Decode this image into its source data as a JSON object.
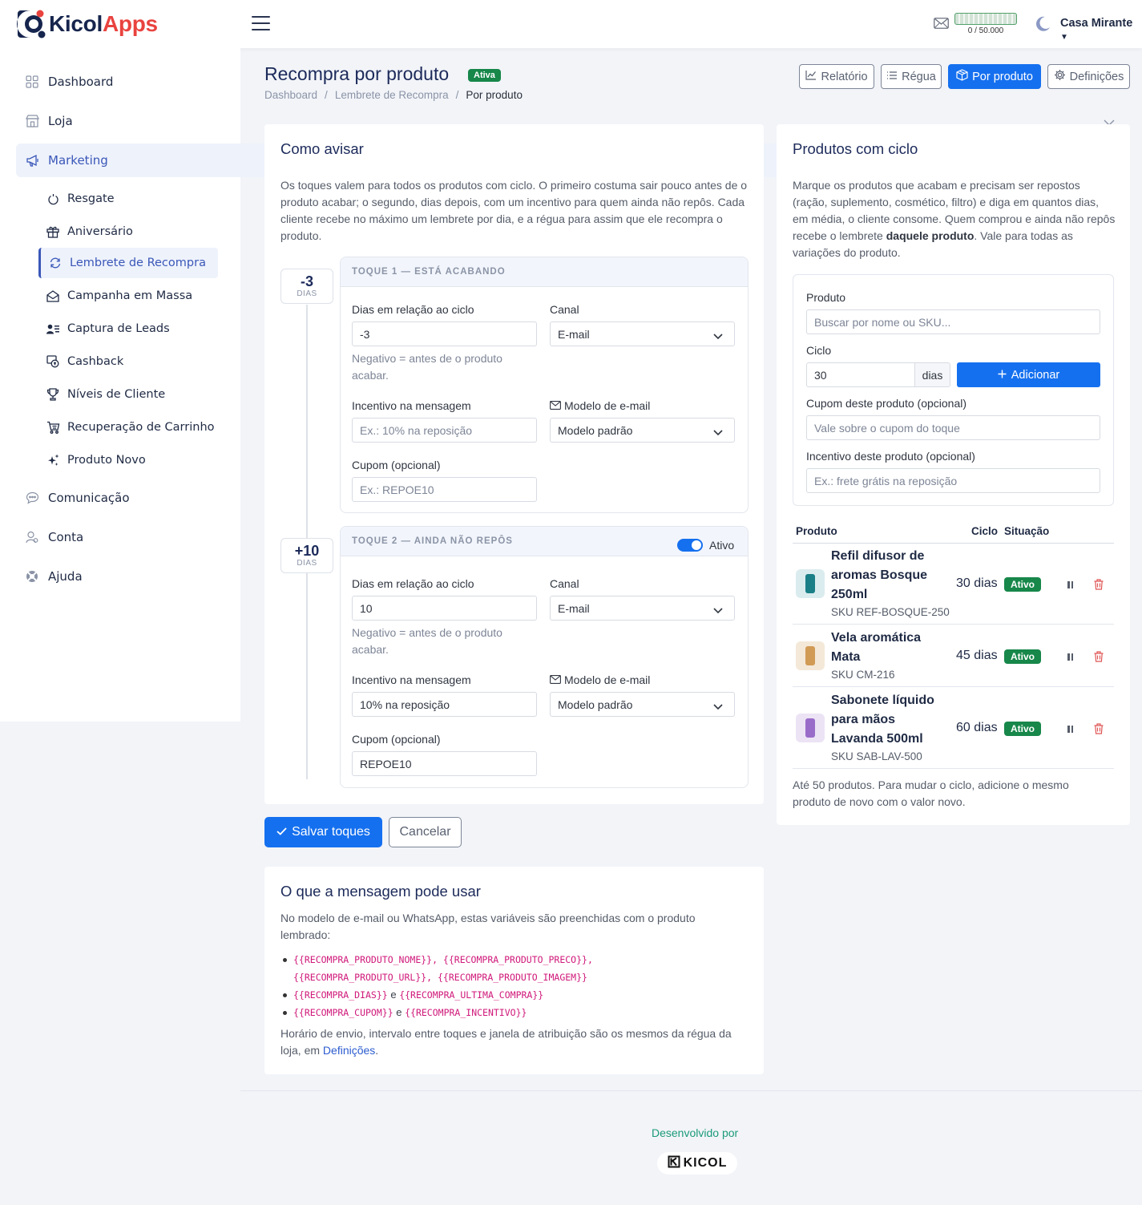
{
  "brand": {
    "name_part1": "Kicol",
    "name_part2": "Apps",
    "accent": "#e9433f",
    "navy": "#16254d"
  },
  "header": {
    "credits": "0 / 50.000",
    "user": "Casa Mirante"
  },
  "sidebar": {
    "items": [
      {
        "label": "Dashboard",
        "icon": "grid-icon"
      },
      {
        "label": "Loja",
        "icon": "store-icon"
      },
      {
        "label": "Marketing",
        "icon": "megaphone-icon"
      },
      {
        "label": "Comunicação",
        "icon": "chat-icon"
      },
      {
        "label": "Conta",
        "icon": "user-icon"
      },
      {
        "label": "Ajuda",
        "icon": "lifebuoy-icon"
      }
    ],
    "marketing_sub": [
      {
        "label": "Resgate",
        "icon": "power-icon"
      },
      {
        "label": "Aniversário",
        "icon": "gift-icon"
      },
      {
        "label": "Lembrete de Recompra",
        "icon": "refresh-icon"
      },
      {
        "label": "Campanha em Massa",
        "icon": "envelope-open-icon"
      },
      {
        "label": "Captura de Leads",
        "icon": "person-lines-icon"
      },
      {
        "label": "Cashback",
        "icon": "cash-icon"
      },
      {
        "label": "Níveis de Cliente",
        "icon": "trophy-icon"
      },
      {
        "label": "Recuperação de Carrinho",
        "icon": "cart-icon"
      },
      {
        "label": "Produto Novo",
        "icon": "sparkle-icon"
      }
    ]
  },
  "page": {
    "title": "Recompra por produto",
    "status": "Ativa",
    "breadcrumb": [
      "Dashboard",
      "Lembrete de Recompra",
      "Por produto"
    ],
    "tabs": [
      "Relatório",
      "Régua",
      "Por produto",
      "Definições"
    ]
  },
  "como_avisar": {
    "title": "Como avisar",
    "desc": "Os toques valem para todos os produtos com ciclo. O primeiro costuma sair pouco antes de o produto acabar; o segundo, dias depois, com um incentivo para quem ainda não repôs. Cada cliente recebe no máximo um lembrete por dia, e a régua para assim que ele recompra o produto.",
    "touches": [
      {
        "day_value": "-3",
        "day_unit": "DIAS",
        "header": "TOQUE 1 — ESTÁ ACABANDO",
        "dias_label": "Dias em relação ao ciclo",
        "dias_value": "-3",
        "hint": "Negativo = antes de o produto acabar.",
        "canal_label": "Canal",
        "canal_value": "E-mail",
        "incentivo_label": "Incentivo na mensagem",
        "incentivo_placeholder": "Ex.: 10% na reposição",
        "incentivo_value": "",
        "modelo_label": "Modelo de e-mail",
        "modelo_value": "Modelo padrão",
        "cupom_label": "Cupom (opcional)",
        "cupom_placeholder": "Ex.: REPOE10",
        "cupom_value": ""
      },
      {
        "day_value": "+10",
        "day_unit": "DIAS",
        "header": "TOQUE 2 — AINDA NÃO REPÔS",
        "toggle_label": "Ativo",
        "dias_label": "Dias em relação ao ciclo",
        "dias_value": "10",
        "hint": "Negativo = antes de o produto acabar.",
        "canal_label": "Canal",
        "canal_value": "E-mail",
        "incentivo_label": "Incentivo na mensagem",
        "incentivo_placeholder": "Ex.: 10% na reposição",
        "incentivo_value": "10% na reposição",
        "modelo_label": "Modelo de e-mail",
        "modelo_value": "Modelo padrão",
        "cupom_label": "Cupom (opcional)",
        "cupom_placeholder": "Ex.: REPOE10",
        "cupom_value": "REPOE10"
      }
    ]
  },
  "actions": {
    "save": "Salvar toques",
    "cancel": "Cancelar"
  },
  "variaveis": {
    "title": "O que a mensagem pode usar",
    "intro": "No modelo de e-mail ou WhatsApp, estas variáveis são preenchidas com o produto lembrado:",
    "line1a": "{{RECOMPRA_PRODUTO_NOME}}, {{RECOMPRA_PRODUTO_PRECO}},",
    "line1b": "{{RECOMPRA_PRODUTO_URL}}, {{RECOMPRA_PRODUTO_IMAGEM}}",
    "line2a": "{{RECOMPRA_DIAS}}",
    "line2_sep": "e",
    "line2b": "{{RECOMPRA_ULTIMA_COMPRA}}",
    "line3a": "{{RECOMPRA_CUPOM}}",
    "line3_sep": "e",
    "line3b": "{{RECOMPRA_INCENTIVO}}",
    "footer_text": "Horário de envio, intervalo entre toques e janela de atribuição são os mesmos da régua da loja, em ",
    "footer_link": "Definições",
    "footer_end": "."
  },
  "produtos": {
    "title": "Produtos com ciclo",
    "desc_a": "Marque os produtos que acabam e precisam ser repostos (ração, suplemento, cosmético, filtro) e diga em quantos dias, em média, o cliente consome. Quem comprou e ainda não repôs recebe o lembrete ",
    "desc_bold": "daquele produto",
    "desc_b": ". Vale para todas as variações do produto.",
    "form": {
      "produto_label": "Produto",
      "produto_placeholder": "Buscar por nome ou SKU...",
      "ciclo_label": "Ciclo",
      "ciclo_value": "30",
      "ciclo_unit": "dias",
      "add_label": "Adicionar",
      "cupom_label": "Cupom deste produto (opcional)",
      "cupom_placeholder": "Vale sobre o cupom do toque",
      "incentivo_label": "Incentivo deste produto (opcional)",
      "incentivo_placeholder": "Ex.: frete grátis na reposição"
    },
    "table": {
      "headers": [
        "Produto",
        "Ciclo",
        "Situação"
      ],
      "rows": [
        {
          "name_lines": [
            "Refil difusor de",
            "aromas Bosque",
            "250ml"
          ],
          "sku": "SKU REF-BOSQUE-250",
          "ciclo": "30 dias",
          "status": "Ativo",
          "thumb_color": "#1a7f86",
          "thumb_bg": "#dbecef"
        },
        {
          "name_lines": [
            "Vela aromática",
            "Mata"
          ],
          "sku": "SKU CM-216",
          "ciclo": "45 dias",
          "status": "Ativo",
          "thumb_color": "#d19a55",
          "thumb_bg": "#f4e8d8"
        },
        {
          "name_lines": [
            "Sabonete líquido",
            "para mãos",
            "Lavanda 500ml"
          ],
          "sku": "SKU SAB-LAV-500",
          "ciclo": "60 dias",
          "status": "Ativo",
          "thumb_color": "#9a6cc9",
          "thumb_bg": "#ece3f5"
        }
      ]
    },
    "note": "Até 50 produtos. Para mudar o ciclo, adicione o mesmo produto de novo com o valor novo."
  },
  "footer": {
    "developed_by": "Desenvolvido por",
    "logo_text": "KICOL"
  }
}
